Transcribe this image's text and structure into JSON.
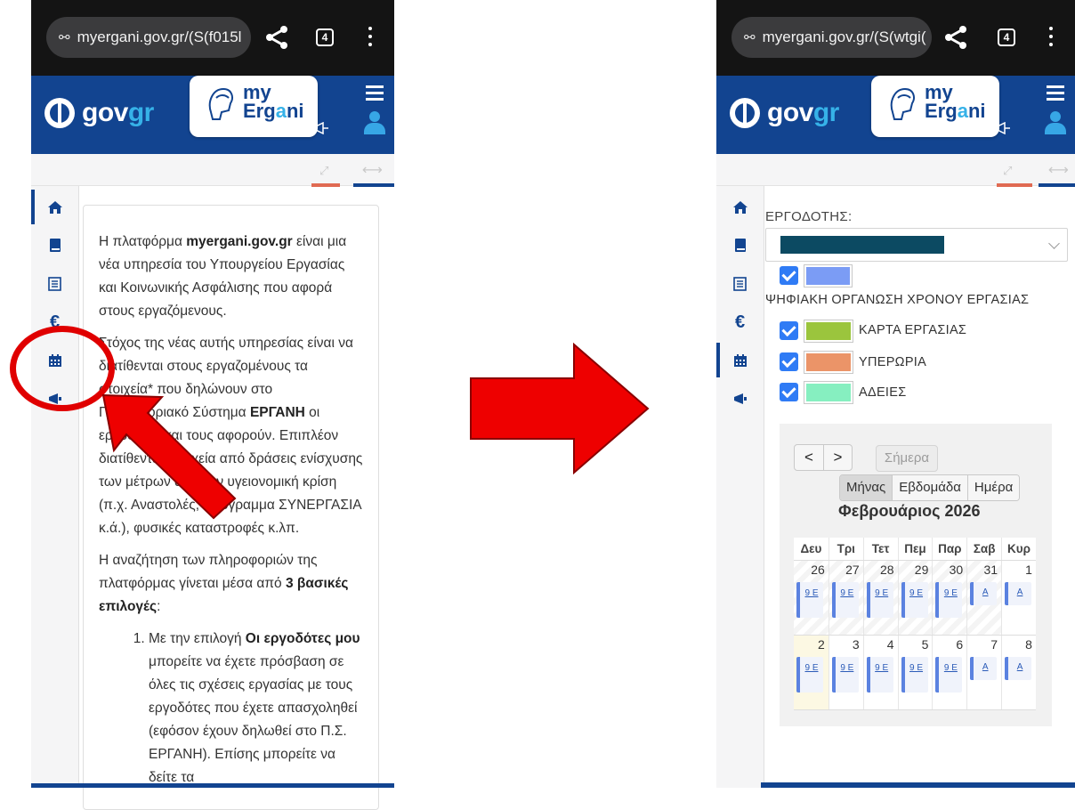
{
  "left_screen": {
    "url": "myergani.gov.gr/(S(f015l",
    "tab_count": "4",
    "gov_logo": "gov",
    "gov_logo_accent": "gr",
    "app_logo_my": "my",
    "app_logo_ergani_pre": "Erg",
    "app_logo_ergani_accent": "a",
    "app_logo_ergani_post": "ni",
    "paragraphs": [
      {
        "pre": "Η πλατφόρμα ",
        "bold": "myergani.gov.gr",
        "post": " είναι μια νέα υπηρεσία του Υπουργείου Εργασίας και Κοινωνικής Ασφάλισης που αφορά στους εργαζόμενους."
      },
      {
        "pre": "Στόχος της νέας αυτής υπηρεσίας είναι να διατίθενται στους εργαζομένους τα στοιχεία* που δηλώνουν στο Πληροφοριακό Σύστημα ",
        "bold": "ΕΡΓΑΝΗ",
        "post": " οι εργοδότες και τους αφορούν. Επιπλέον διατίθενται στοιχεία από δράσεις ενίσχυσης των μέτρων από την υγειονομική κρίση (π.χ. Αναστολές, πρόγραμμα ΣΥΝΕΡΓΑΣΙΑ κ.ά.), φυσικές καταστροφές κ.λπ."
      },
      {
        "pre": "Η αναζήτηση των πληροφοριών της πλατφόρμας γίνεται μέσα από ",
        "bold": "3 βασικές επιλογές",
        "post": ":"
      }
    ],
    "list_item": {
      "pre": "Με την επιλογή ",
      "bold": "Οι εργοδότες μου",
      "post": " μπορείτε να έχετε πρόσβαση σε όλες τις σχέσεις εργασίας με τους εργοδότες που έχετε απασχοληθεί (εφόσον έχουν δηλωθεί στο Π.Σ. ΕΡΓΑΝΗ). Επίσης μπορείτε να δείτε τα"
    }
  },
  "right_screen": {
    "url": "myergani.gov.gr/(S(wtgi(",
    "tab_count": "4",
    "employer_label": "ΕΡΓΟΔΟΤΗΣ:",
    "digital_org_label": "ΨΗΦΙΑΚΗ ΟΡΓΑΝΩΣΗ ΧΡΟΝΟΥ ΕΡΓΑΣΙΑΣ",
    "legend": [
      {
        "label": "ΚΑΡΤΑ ΕΡΓΑΣΙΑΣ",
        "color": "#9bc53d"
      },
      {
        "label": "ΥΠΕΡΩΡΙΑ",
        "color": "#eb9468"
      },
      {
        "label": "ΑΔΕΙΕΣ",
        "color": "#86efc0"
      }
    ],
    "employer_swatch_color": "#7b9cf5",
    "calendar": {
      "prev": "<",
      "next": ">",
      "today": "Σήμερα",
      "views": [
        "Μήνας",
        "Εβδομάδα",
        "Ημέρα"
      ],
      "active_view": "Μήνας",
      "title": "Φεβρουάριος 2026",
      "weekdays": [
        "Δευ",
        "Τρι",
        "Τετ",
        "Πεμ",
        "Παρ",
        "Σαβ",
        "Κυρ"
      ],
      "week1": [
        "26",
        "27",
        "28",
        "29",
        "30",
        "31",
        "1"
      ],
      "week2": [
        "2",
        "3",
        "4",
        "5",
        "6",
        "7",
        "8"
      ],
      "event_long": "9 Ε",
      "event_short": "Α"
    }
  }
}
